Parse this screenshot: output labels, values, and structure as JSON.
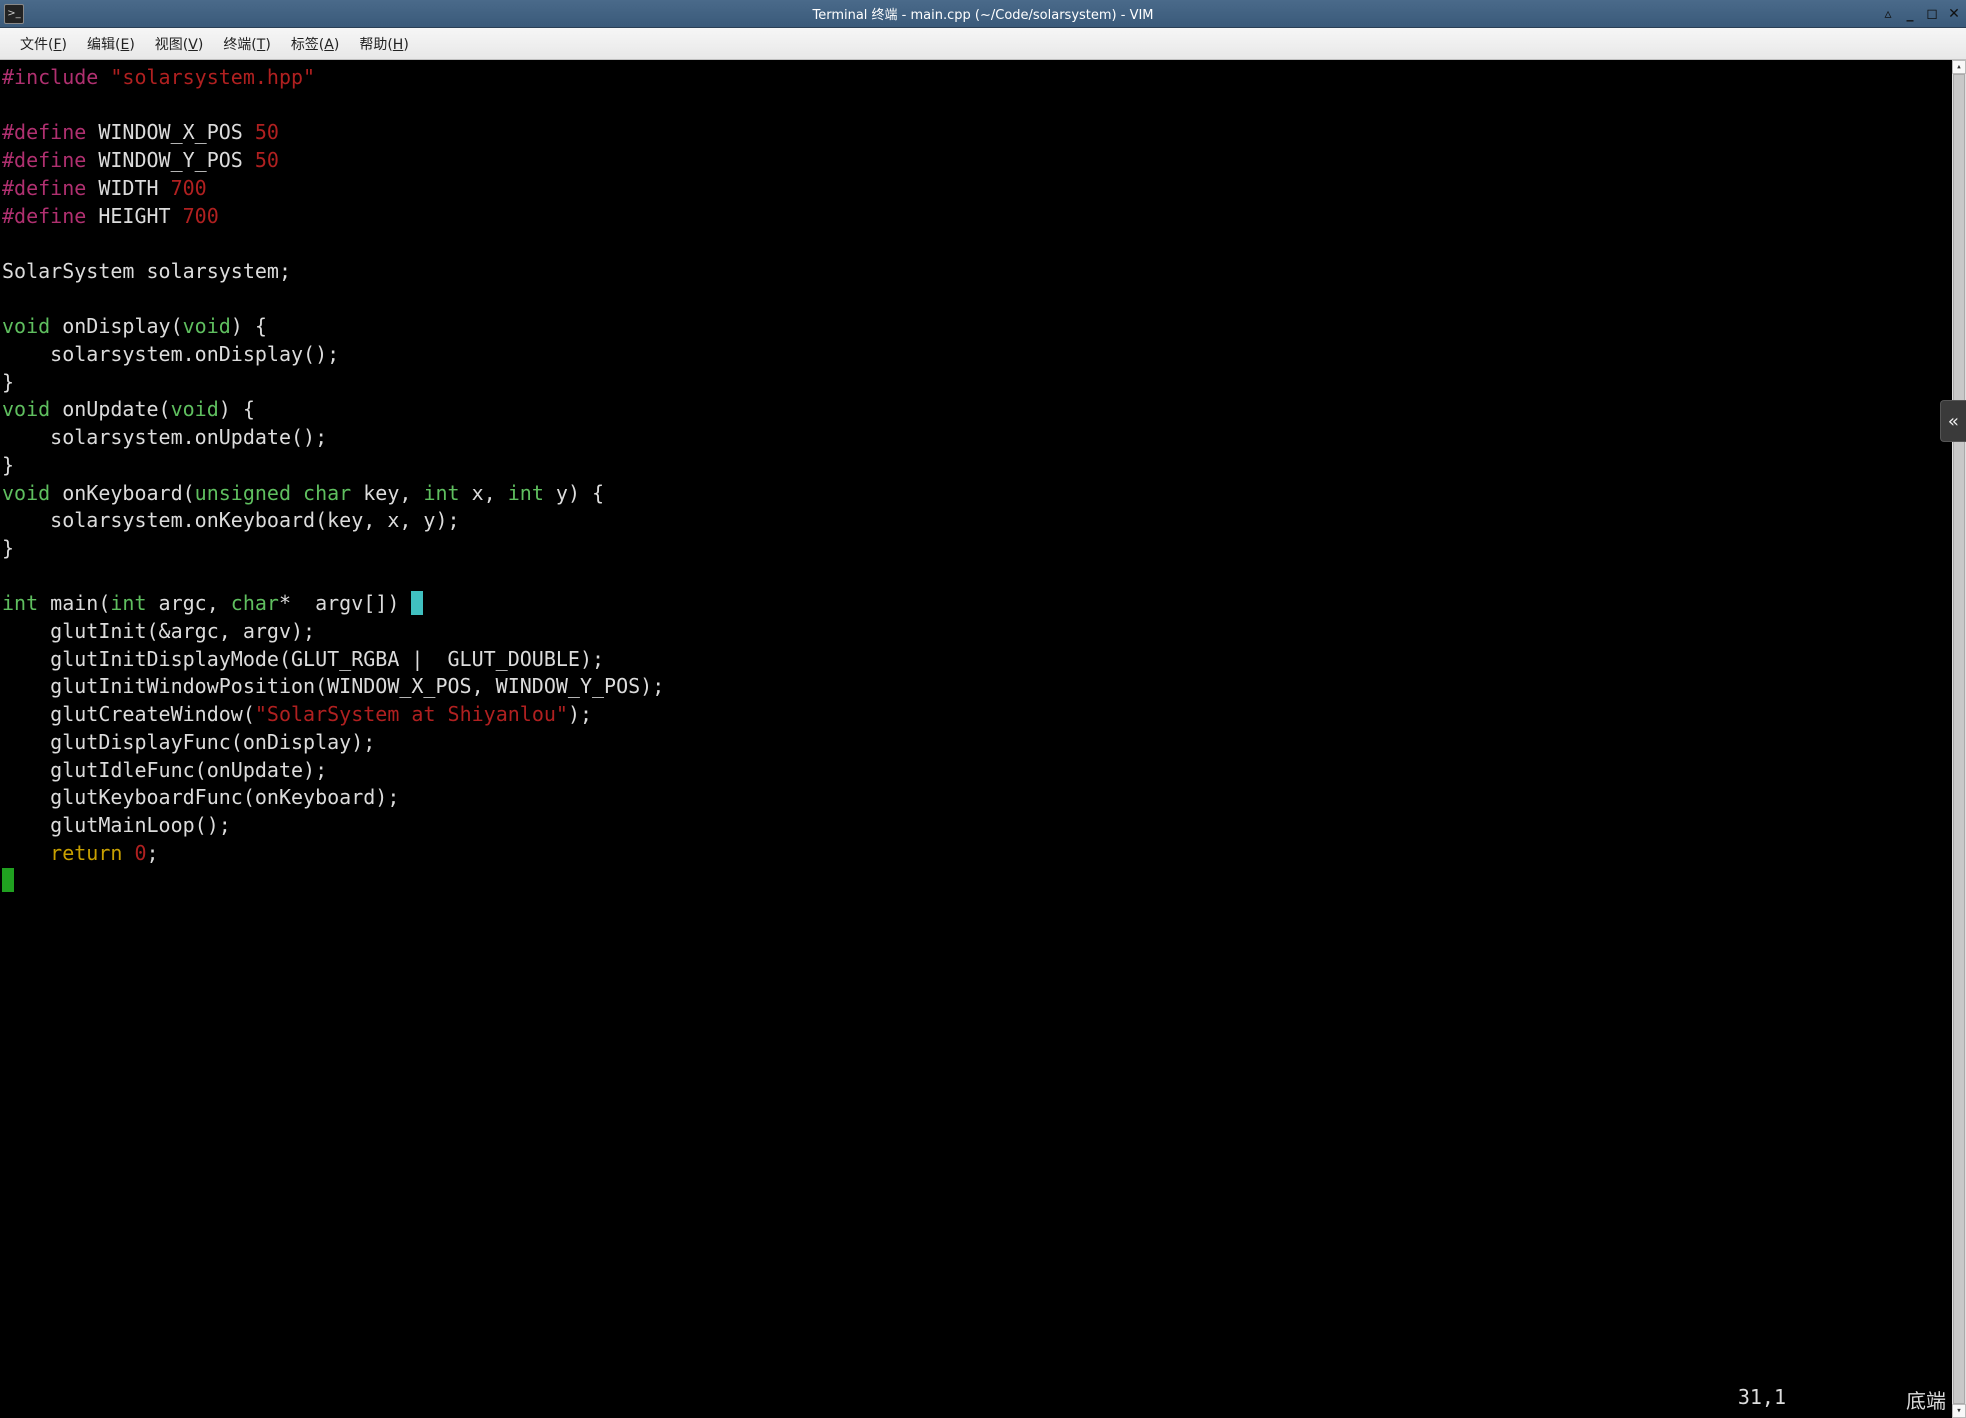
{
  "window": {
    "title": "Terminal 终端 - main.cpp (~/Code/solarsystem) - VIM",
    "app_icon_glyph": ">_"
  },
  "menu": {
    "items": [
      {
        "label": "文件",
        "accel": "F"
      },
      {
        "label": "编辑",
        "accel": "E"
      },
      {
        "label": "视图",
        "accel": "V"
      },
      {
        "label": "终端",
        "accel": "T"
      },
      {
        "label": "标签",
        "accel": "A"
      },
      {
        "label": "帮助",
        "accel": "H"
      }
    ]
  },
  "code": {
    "lines": [
      [
        {
          "c": "pre",
          "t": "#include "
        },
        {
          "c": "str",
          "t": "\"solarsystem.hpp\""
        }
      ],
      [],
      [
        {
          "c": "pre",
          "t": "#define "
        },
        {
          "c": "txt",
          "t": "WINDOW_X_POS "
        },
        {
          "c": "num",
          "t": "50"
        }
      ],
      [
        {
          "c": "pre",
          "t": "#define "
        },
        {
          "c": "txt",
          "t": "WINDOW_Y_POS "
        },
        {
          "c": "num",
          "t": "50"
        }
      ],
      [
        {
          "c": "pre",
          "t": "#define "
        },
        {
          "c": "txt",
          "t": "WIDTH "
        },
        {
          "c": "num",
          "t": "700"
        }
      ],
      [
        {
          "c": "pre",
          "t": "#define "
        },
        {
          "c": "txt",
          "t": "HEIGHT "
        },
        {
          "c": "num",
          "t": "700"
        }
      ],
      [],
      [
        {
          "c": "txt",
          "t": "SolarSystem solarsystem;"
        }
      ],
      [],
      [
        {
          "c": "type",
          "t": "void"
        },
        {
          "c": "txt",
          "t": " onDisplay("
        },
        {
          "c": "type",
          "t": "void"
        },
        {
          "c": "txt",
          "t": ") {"
        }
      ],
      [
        {
          "c": "txt",
          "t": "    solarsystem.onDisplay();"
        }
      ],
      [
        {
          "c": "txt",
          "t": "}"
        }
      ],
      [
        {
          "c": "type",
          "t": "void"
        },
        {
          "c": "txt",
          "t": " onUpdate("
        },
        {
          "c": "type",
          "t": "void"
        },
        {
          "c": "txt",
          "t": ") {"
        }
      ],
      [
        {
          "c": "txt",
          "t": "    solarsystem.onUpdate();"
        }
      ],
      [
        {
          "c": "txt",
          "t": "}"
        }
      ],
      [
        {
          "c": "type",
          "t": "void"
        },
        {
          "c": "txt",
          "t": " onKeyboard("
        },
        {
          "c": "type",
          "t": "unsigned char"
        },
        {
          "c": "txt",
          "t": " key, "
        },
        {
          "c": "type",
          "t": "int"
        },
        {
          "c": "txt",
          "t": " x, "
        },
        {
          "c": "type",
          "t": "int"
        },
        {
          "c": "txt",
          "t": " y) {"
        }
      ],
      [
        {
          "c": "txt",
          "t": "    solarsystem.onKeyboard(key, x, y);"
        }
      ],
      [
        {
          "c": "txt",
          "t": "}"
        }
      ],
      [],
      [
        {
          "c": "type",
          "t": "int"
        },
        {
          "c": "txt",
          "t": " main("
        },
        {
          "c": "type",
          "t": "int"
        },
        {
          "c": "txt",
          "t": " argc, "
        },
        {
          "c": "type",
          "t": "char"
        },
        {
          "c": "txt",
          "t": "*  argv[]) "
        },
        {
          "c": "cursor",
          "t": "{"
        }
      ],
      [
        {
          "c": "txt",
          "t": "    glutInit(&argc, argv);"
        }
      ],
      [
        {
          "c": "txt",
          "t": "    glutInitDisplayMode(GLUT_RGBA |  GLUT_DOUBLE);"
        }
      ],
      [
        {
          "c": "txt",
          "t": "    glutInitWindowPosition(WINDOW_X_POS, WINDOW_Y_POS);"
        }
      ],
      [
        {
          "c": "txt",
          "t": "    glutCreateWindow("
        },
        {
          "c": "str",
          "t": "\"SolarSystem at Shiyanlou\""
        },
        {
          "c": "txt",
          "t": ");"
        }
      ],
      [
        {
          "c": "txt",
          "t": "    glutDisplayFunc(onDisplay);"
        }
      ],
      [
        {
          "c": "txt",
          "t": "    glutIdleFunc(onUpdate);"
        }
      ],
      [
        {
          "c": "txt",
          "t": "    glutKeyboardFunc(onKeyboard);"
        }
      ],
      [
        {
          "c": "txt",
          "t": "    glutMainLoop();"
        }
      ],
      [
        {
          "c": "txt",
          "t": "    "
        },
        {
          "c": "kw",
          "t": "return"
        },
        {
          "c": "txt",
          "t": " "
        },
        {
          "c": "num",
          "t": "0"
        },
        {
          "c": "txt",
          "t": ";"
        }
      ],
      [
        {
          "c": "match",
          "t": "}"
        }
      ]
    ]
  },
  "status": {
    "pos": "31,1",
    "where": "底端"
  },
  "side_tab_glyph": "«"
}
